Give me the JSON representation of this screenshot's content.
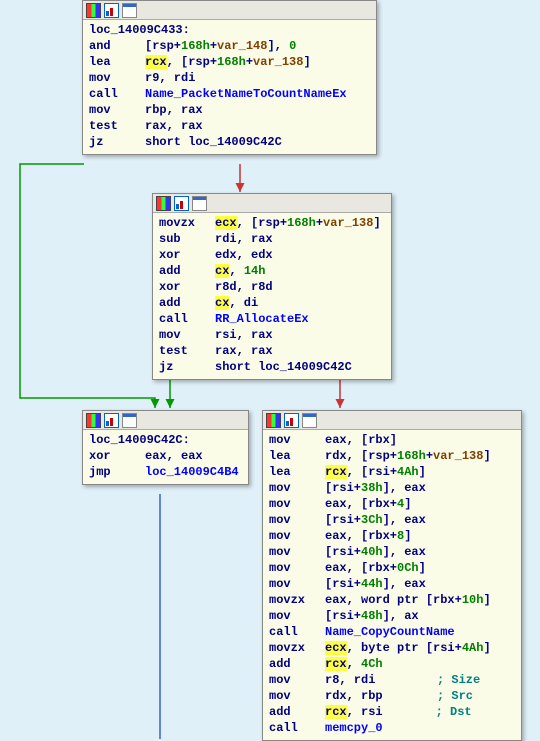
{
  "block1": {
    "label": "loc_14009C433:",
    "l1_op": "and",
    "l1_t": "[rsp+",
    "l1_n1": "168h",
    "l1_t2": "+",
    "l1_v": "var_148",
    "l1_t3": "], ",
    "l1_n2": "0",
    "l2_op": "lea",
    "l2_r": "rcx",
    "l2_t": ", [rsp+",
    "l2_n": "168h",
    "l2_t2": "+",
    "l2_v": "var_138",
    "l2_t3": "]",
    "l3_op": "mov",
    "l3_t": "r9, rdi",
    "l4_op": "call",
    "l4_name": "Name_PacketNameToCountNameEx",
    "l5_op": "mov",
    "l5_t": "rbp, rax",
    "l6_op": "test",
    "l6_t": "rax, rax",
    "l7_op": "jz",
    "l7_t": "short loc_14009C42C"
  },
  "block2": {
    "l1_op": "movzx",
    "l1_r": "ecx",
    "l1_t": ", [rsp+",
    "l1_n": "168h",
    "l1_t2": "+",
    "l1_v": "var_138",
    "l1_t3": "]",
    "l2_op": "sub",
    "l2_t": "rdi, rax",
    "l3_op": "xor",
    "l3_t": "edx, edx",
    "l4_op": "add",
    "l4_r": "cx",
    "l4_t": ", ",
    "l4_n": "14h",
    "l5_op": "xor",
    "l5_t": "r8d, r8d",
    "l6_op": "add",
    "l6_r": "cx",
    "l6_t": ", di",
    "l7_op": "call",
    "l7_name": "RR_AllocateEx",
    "l8_op": "mov",
    "l8_t": "rsi, rax",
    "l9_op": "test",
    "l9_t": "rax, rax",
    "l10_op": "jz",
    "l10_t": "short loc_14009C42C"
  },
  "block3": {
    "label": "loc_14009C42C:",
    "l1_op": "xor",
    "l1_t": "eax, eax",
    "l2_op": "jmp",
    "l2_name": "loc_14009C4B4"
  },
  "block4": {
    "l1_op": "mov",
    "l1_t": "eax, [rbx]",
    "l2_op": "lea",
    "l2_t": "rdx, [rsp+",
    "l2_n": "168h",
    "l2_t2": "+",
    "l2_v": "var_138",
    "l2_t3": "]",
    "l3_op": "lea",
    "l3_r": "rcx",
    "l3_t": ", [rsi+",
    "l3_n": "4Ah",
    "l3_t2": "]",
    "l4_op": "mov",
    "l4_t": "[rsi+",
    "l4_n": "38h",
    "l4_t2": "], eax",
    "l5_op": "mov",
    "l5_t": "eax, [rbx+",
    "l5_n": "4",
    "l5_t2": "]",
    "l6_op": "mov",
    "l6_t": "[rsi+",
    "l6_n": "3Ch",
    "l6_t2": "], eax",
    "l7_op": "mov",
    "l7_t": "eax, [rbx+",
    "l7_n": "8",
    "l7_t2": "]",
    "l8_op": "mov",
    "l8_t": "[rsi+",
    "l8_n": "40h",
    "l8_t2": "], eax",
    "l9_op": "mov",
    "l9_t": "eax, [rbx+",
    "l9_n": "0Ch",
    "l9_t2": "]",
    "l10_op": "mov",
    "l10_t": "[rsi+",
    "l10_n": "44h",
    "l10_t2": "], eax",
    "l11_op": "movzx",
    "l11_t": "eax, word ptr [rbx+",
    "l11_n": "10h",
    "l11_t2": "]",
    "l12_op": "mov",
    "l12_t": "[rsi+",
    "l12_n": "48h",
    "l12_t2": "], ax",
    "l13_op": "call",
    "l13_name": "Name_CopyCountName",
    "l14_op": "movzx",
    "l14_r": "ecx",
    "l14_t": ", byte ptr [rsi+",
    "l14_n": "4Ah",
    "l14_t2": "]",
    "l15_op": "add",
    "l15_r": "rcx",
    "l15_t": ", ",
    "l15_n": "4Ch",
    "l16_op": "mov",
    "l16_t": "r8, rdi",
    "l16_c": "; Size",
    "l17_op": "mov",
    "l17_t": "rdx, rbp",
    "l17_c": "; Src",
    "l18_op": "add",
    "l18_r": "rcx",
    "l18_t": ", rsi",
    "l18_c": "; Dst",
    "l19_op": "call",
    "l19_name": "memcpy_0"
  }
}
